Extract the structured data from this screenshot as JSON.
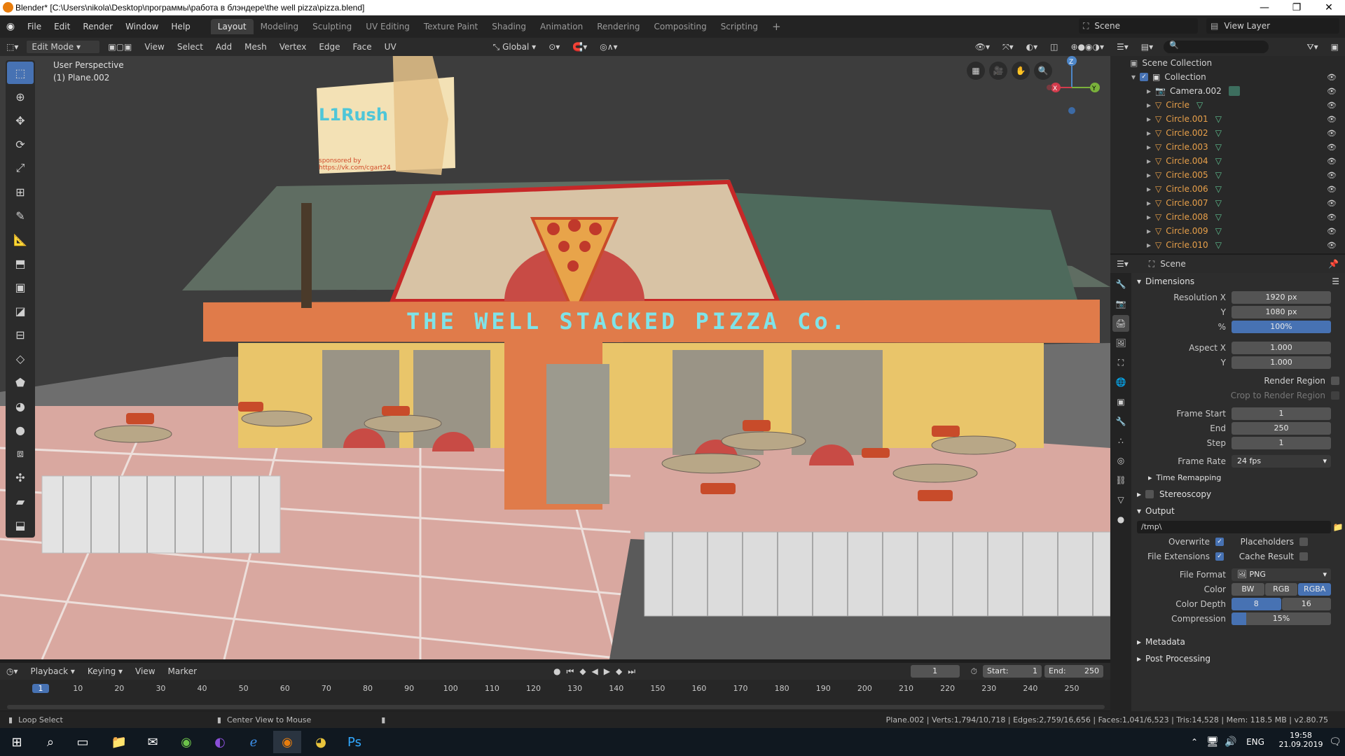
{
  "window": {
    "title": "Blender* [C:\\Users\\nikola\\Desktop\\программы\\работа в блэндере\\the well pizza\\pizza.blend]",
    "controls": [
      "—",
      "❐",
      "✕"
    ]
  },
  "menu": {
    "items": [
      "File",
      "Edit",
      "Render",
      "Window",
      "Help"
    ],
    "workspaces": [
      "Layout",
      "Modeling",
      "Sculpting",
      "UV Editing",
      "Texture Paint",
      "Shading",
      "Animation",
      "Rendering",
      "Compositing",
      "Scripting"
    ],
    "active_workspace": "Layout",
    "add_tab": "+",
    "scene_label": "Scene",
    "view_layer_label": "View Layer"
  },
  "viewport_header": {
    "mode": "Edit Mode",
    "items": [
      "View",
      "Select",
      "Add",
      "Mesh",
      "Vertex",
      "Edge",
      "Face",
      "UV"
    ],
    "orientation": "Global"
  },
  "viewport": {
    "perspective": "User Perspective",
    "object": "(1) Plane.002",
    "sign_text": "THE WELL STACKED  PIZZA Co.",
    "billboard_text": "L1Rush",
    "billboard_sponsor": "sponsored by",
    "billboard_url": "https://vk.com/cgart24",
    "gizmo_axes": [
      "X",
      "Y",
      "Z"
    ]
  },
  "outliner": {
    "root": "Scene Collection",
    "collection": "Collection",
    "items": [
      "Camera.002",
      "Circle",
      "Circle.001",
      "Circle.002",
      "Circle.003",
      "Circle.004",
      "Circle.005",
      "Circle.006",
      "Circle.007",
      "Circle.008",
      "Circle.009",
      "Circle.010"
    ]
  },
  "properties": {
    "context": "Scene",
    "dimensions": {
      "title": "Dimensions",
      "res_x_label": "Resolution X",
      "res_x": "1920 px",
      "res_y_label": "Y",
      "res_y": "1080 px",
      "res_pct_label": "%",
      "res_pct": "100%",
      "aspect_x_label": "Aspect X",
      "aspect_x": "1.000",
      "aspect_y_label": "Y",
      "aspect_y": "1.000",
      "render_region": "Render Region",
      "crop_region": "Crop to Render Region",
      "frame_start_label": "Frame Start",
      "frame_start": "1",
      "end_label": "End",
      "end": "250",
      "step_label": "Step",
      "step": "1",
      "frame_rate_label": "Frame Rate",
      "frame_rate": "24 fps",
      "time_remapping": "Time Remapping"
    },
    "stereoscopy": "Stereoscopy",
    "output": {
      "title": "Output",
      "path": "/tmp\\",
      "overwrite": "Overwrite",
      "placeholders": "Placeholders",
      "file_extensions": "File Extensions",
      "cache_result": "Cache Result",
      "file_format_label": "File Format",
      "file_format": "PNG",
      "color_label": "Color",
      "color_options": [
        "BW",
        "RGB",
        "RGBA"
      ],
      "color_selected": "RGBA",
      "color_depth_label": "Color Depth",
      "depth_options": [
        "8",
        "16"
      ],
      "depth_selected": "8",
      "compression_label": "Compression",
      "compression": "15%",
      "compression_value": 0.15
    },
    "metadata": "Metadata",
    "post_processing": "Post Processing"
  },
  "timeline": {
    "menus": [
      "Playback",
      "Keying",
      "View",
      "Marker"
    ],
    "current_frame": "1",
    "start_label": "Start:",
    "start": "1",
    "end_label": "End:",
    "end": "250",
    "ticks": [
      "1",
      "10",
      "20",
      "30",
      "40",
      "50",
      "60",
      "70",
      "80",
      "90",
      "100",
      "110",
      "120",
      "130",
      "140",
      "150",
      "160",
      "170",
      "180",
      "190",
      "200",
      "210",
      "220",
      "230",
      "240",
      "250"
    ]
  },
  "statusbar": {
    "left": "Loop Select",
    "middle": "Center View to Mouse",
    "stats": "Plane.002 | Verts:1,794/10,718 | Edges:2,759/16,656 | Faces:1,041/6,523 | Tris:14,528 | Mem: 118.5 MB | v2.80.75"
  },
  "taskbar": {
    "lang": "ENG",
    "time": "19:58",
    "date": "21.09.2019"
  },
  "colors": {
    "accent": "#4772b3",
    "object_orange": "#e8a04a",
    "viewport_bg": "#3d3d3d",
    "building_orange": "#e07b4a"
  }
}
